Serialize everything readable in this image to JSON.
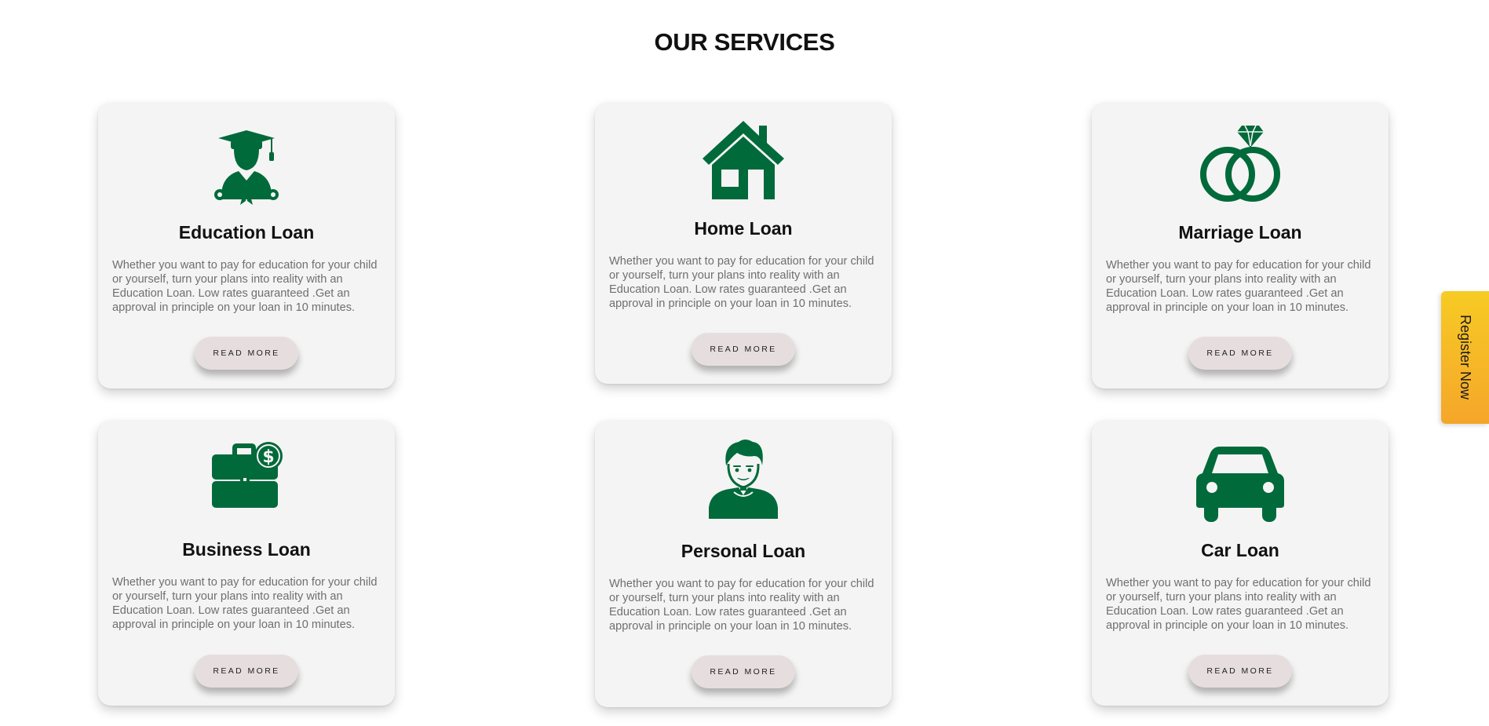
{
  "section": {
    "title": "OUR SERVICES"
  },
  "colors": {
    "icon_green": "#006a3a",
    "card_bg": "#f5f4f4",
    "button_bg": "#e6dede",
    "register_gradient_top": "#f7cb24",
    "register_gradient_bottom": "#f5a62a"
  },
  "cards": [
    {
      "icon": "graduate-icon",
      "title": "Education Loan",
      "description": "Whether you want to pay for education for your child or yourself, turn your plans into reality with an Education Loan. Low rates guaranteed .Get an approval in principle on your loan in 10 minutes.",
      "button": "READ MORE"
    },
    {
      "icon": "house-icon",
      "title": "Home Loan",
      "description": "Whether you want to pay for education for your child or yourself, turn your plans into reality with an Education Loan. Low rates guaranteed .Get an approval in principle on your loan in 10 minutes.",
      "button": "READ MORE"
    },
    {
      "icon": "wedding-rings-icon",
      "title": "Marriage Loan",
      "description": "Whether you want to pay for education for your child or yourself, turn your plans into reality with an Education Loan. Low rates guaranteed .Get an approval in principle on your loan in 10 minutes.",
      "button": "READ MORE"
    },
    {
      "icon": "briefcase-dollar-icon",
      "title": "Business Loan",
      "description": "Whether you want to pay for education for your child or yourself, turn your plans into reality with an Education Loan. Low rates guaranteed .Get an approval in principle on your loan in 10 minutes.",
      "button": "READ MORE"
    },
    {
      "icon": "person-icon",
      "title": "Personal Loan",
      "description": "Whether you want to pay for education for your child or yourself, turn your plans into reality with an Education Loan. Low rates guaranteed .Get an approval in principle on your loan in 10 minutes.",
      "button": "READ MORE"
    },
    {
      "icon": "car-icon",
      "title": "Car Loan",
      "description": "Whether you want to pay for education for your child or yourself, turn your plans into reality with an Education Loan. Low rates guaranteed .Get an approval in principle on your loan in 10 minutes.",
      "button": "READ MORE"
    }
  ],
  "register_tab": {
    "label": "Register Now"
  }
}
